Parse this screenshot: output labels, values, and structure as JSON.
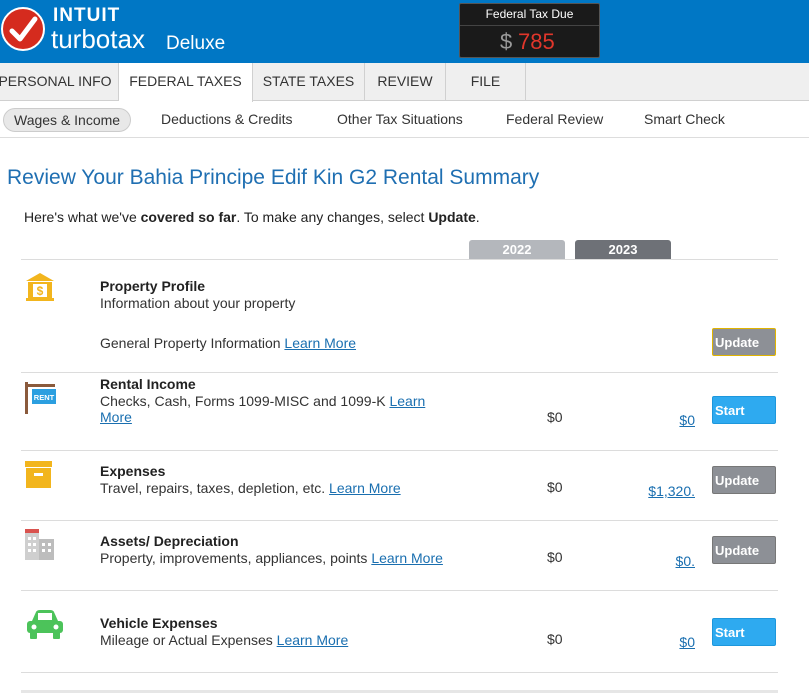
{
  "header": {
    "brand_intuit": "INTUIT",
    "brand_product": "turbotax",
    "brand_edition": "Deluxe",
    "tax_due_label": "Federal Tax Due",
    "tax_due_currency": "$",
    "tax_due_amount": "785",
    "colors": {
      "brand_blue": "#0077c5",
      "check_red": "#d52b1e",
      "amount_red": "#e0362b"
    }
  },
  "tabs": [
    {
      "label": "PERSONAL INFO"
    },
    {
      "label": "FEDERAL TAXES"
    },
    {
      "label": "STATE TAXES"
    },
    {
      "label": "REVIEW"
    },
    {
      "label": "FILE"
    }
  ],
  "subnav": [
    {
      "label": "Wages & Income"
    },
    {
      "label": "Deductions & Credits"
    },
    {
      "label": "Other Tax Situations"
    },
    {
      "label": "Federal Review"
    },
    {
      "label": "Smart Check"
    }
  ],
  "page": {
    "title": "Review Your Bahia Principe Edif Kin G2 Rental Summary",
    "intro_part1": "Here's what we've ",
    "intro_bold1": "covered so far",
    "intro_part2": ". To make any changes, select ",
    "intro_bold2": "Update",
    "intro_part3": "."
  },
  "years": {
    "prior": "2022",
    "current": "2023"
  },
  "rows": {
    "profile": {
      "icon": "bank-building-icon",
      "title": "Property Profile",
      "desc": "Information about your property",
      "sub_label": "General Property Information",
      "link": "Learn More",
      "button": "Update"
    },
    "income": {
      "icon": "rent-sign-icon",
      "icon_text": "RENT",
      "title": "Rental Income",
      "desc": "Checks, Cash, Forms 1099-MISC and 1099-K",
      "link_part1": "Learn",
      "link_part2": "More",
      "val_2022": "$0",
      "val_2023": "$0",
      "button": "Start"
    },
    "expenses": {
      "icon": "storage-box-icon",
      "title": "Expenses",
      "desc": "Travel, repairs, taxes, depletion, etc.",
      "link": "Learn More",
      "val_2022": "$0",
      "val_2023": "$1,320.",
      "button": "Update"
    },
    "assets": {
      "icon": "buildings-icon",
      "title": "Assets/ Depreciation",
      "desc": "Property, improvements, appliances, points",
      "link": "Learn More",
      "val_2022": "$0",
      "val_2023": "$0.",
      "button": "Update"
    },
    "vehicle": {
      "icon": "car-icon",
      "title": "Vehicle Expenses",
      "desc": "Mileage or Actual Expenses",
      "link": "Learn More",
      "val_2022": "$0",
      "val_2023": "$0",
      "button": "Start"
    }
  }
}
